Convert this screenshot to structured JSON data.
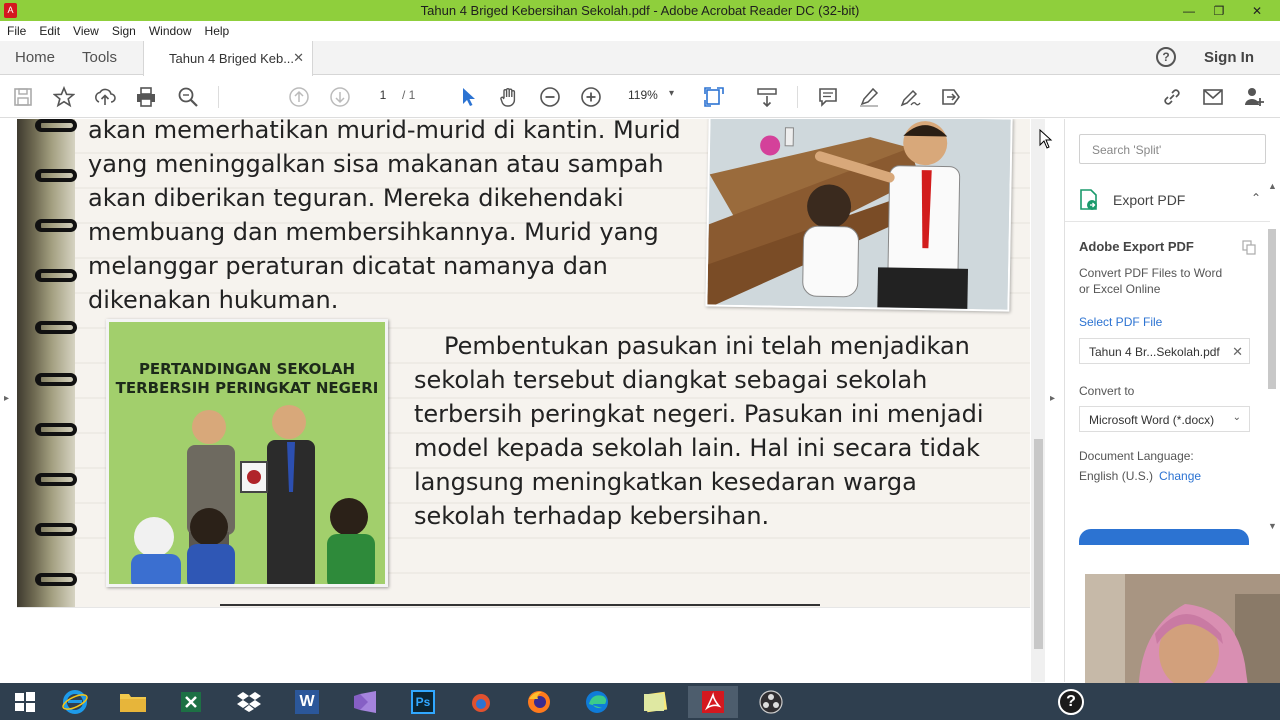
{
  "window": {
    "title": "Tahun 4 Briged Kebersihan Sekolah.pdf - Adobe Acrobat Reader DC (32-bit)",
    "app_icon_glyph": "A",
    "minimize_glyph": "—",
    "maximize_glyph": "❐",
    "close_glyph": "✕"
  },
  "menu": [
    "File",
    "Edit",
    "View",
    "Sign",
    "Window",
    "Help"
  ],
  "tabs": {
    "home": "Home",
    "tools": "Tools",
    "doc_tab": "Tahun 4 Briged Keb...",
    "doc_tab_close": "✕",
    "help": "?",
    "sign_in": "Sign In"
  },
  "toolbar": {
    "page_current": "1",
    "page_total": "/ 1",
    "zoom": "119%",
    "zoom_caret": "▾",
    "icons": [
      "save-icon",
      "star-icon",
      "upload-icon",
      "print-icon",
      "search-icon",
      "page-up-icon",
      "page-down-icon",
      "select-cursor-icon",
      "hand-icon",
      "zoom-out-icon",
      "zoom-in-icon",
      "fit-page-icon",
      "scroll-mode-icon",
      "comment-icon",
      "highlight-icon",
      "sign-icon",
      "share-icon",
      "link-icon",
      "email-icon",
      "add-user-icon"
    ]
  },
  "document": {
    "paragraph1": "akan memerhatikan murid-murid di kantin. Murid yang meninggalkan sisa makanan atau sampah akan diberikan teguran. Mereka dikehendaki membuang dan membersihkannya. Murid yang melanggar peraturan dicatat namanya dan dikenakan hukuman.",
    "paragraph2": "Pembentukan pasukan ini telah menjadikan sekolah tersebut diangkat sebagai sekolah terbersih peringkat negeri. Pasukan ini menjadi model kepada sekolah lain. Hal ini secara tidak langsung meningkatkan kesedaran warga sekolah terhadap kebersihan.",
    "banner_line1": "PERTANDINGAN SEKOLAH",
    "banner_line2": "TERBERSIH PERINGKAT NEGERI"
  },
  "scroll": {
    "left_arrow": "▸",
    "right_arrow": "▸",
    "up": "▲",
    "down": "▼"
  },
  "panel": {
    "search_placeholder": "Search 'Split'",
    "export_title": "Export PDF",
    "export_caret": "⌃",
    "adobe_export_title": "Adobe Export PDF",
    "adobe_export_desc": "Convert PDF Files to Word or Excel Online",
    "select_file_label": "Select PDF File",
    "file_name": "Tahun 4 Br...Sekolah.pdf",
    "file_remove": "✕",
    "convert_to_label": "Convert to",
    "convert_to_value": "Microsoft Word (*.docx)",
    "convert_caret": "⌄",
    "doc_language_label": "Document Language:",
    "doc_language_value": "English (U.S.)",
    "change_link": "Change"
  },
  "taskbar": {
    "items": [
      "windows-start-icon",
      "internet-explorer-icon",
      "file-explorer-icon",
      "excel-icon",
      "dropbox-icon",
      "word-icon",
      "visual-studio-icon",
      "photoshop-icon",
      "firefox-dev-icon",
      "firefox-icon",
      "edge-icon",
      "sticky-notes-icon",
      "acrobat-icon",
      "obs-icon",
      "help-icon"
    ],
    "word_letter": "W",
    "ps_letters": "Ps",
    "help_glyph": "?"
  },
  "colors": {
    "titlebar": "#8fcf3c",
    "taskbar": "#2f3f4f",
    "accent_blue": "#2c73d2",
    "acrobat_red": "#d4181f"
  }
}
